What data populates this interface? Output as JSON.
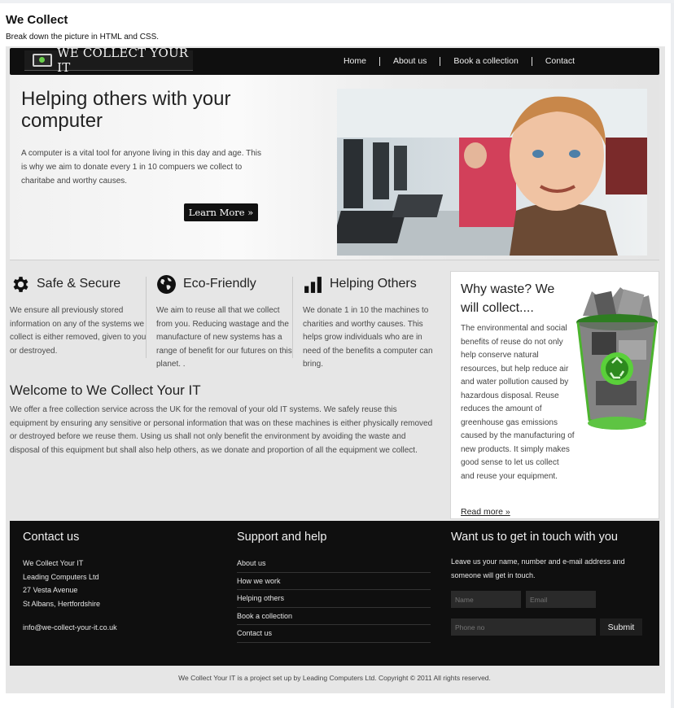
{
  "page": {
    "title": "We Collect",
    "subtitle": "Break down the picture in HTML and CSS."
  },
  "header": {
    "logo_text": "WE COLLECT YOUR IT",
    "nav": [
      "Home",
      "About us",
      "Book a collection",
      "Contact"
    ]
  },
  "hero": {
    "heading": "Helping others with your computer",
    "text": "A computer is a vital tool for anyone living in this day and age. This is why we aim to donate every 1 in 10 compuers we collect to charitabe and worthy causes.",
    "button": "Learn More »"
  },
  "features": [
    {
      "icon": "gear-icon",
      "title": "Safe & Secure",
      "text": "We ensure all previously stored information on any of the systems we collect is either removed, given to you or destroyed."
    },
    {
      "icon": "globe-icon",
      "title": "Eco-Friendly",
      "text": "We aim to reuse all that we collect from you. Reducing wastage and the manufacture of new systems has a range of benefit for our futures on this planet. ."
    },
    {
      "icon": "bar-chart-icon",
      "title": "Helping Others",
      "text": "We donate 1 in 10 the machines to charities and worthy causes. This helps grow individuals who are in need of the benefits a computer can bring."
    }
  ],
  "welcome": {
    "heading": "Welcome to We Collect Your IT",
    "text": "We offer a free collection service across the UK for the removal of your old IT systems. We safely reuse this equipment by ensuring any sensitive or personal information that was on these machines is either physically removed or destroyed before we reuse them. Using us shall not only benefit the environment by avoiding the waste and disposal of this equipment but shall also help others, as we donate and proportion of all the equipment we collect."
  },
  "sidebar": {
    "heading": "Why waste? We will collect....",
    "text": "The environmental and social benefits of reuse do not only help conserve natural resources, but help reduce air and water pollution caused by hazardous disposal. Reuse reduces the amount of greenhouse gas emissions caused by the manufacturing of new products. It simply makes good sense to let us collect and reuse your equipment.",
    "read_more": "Read more »"
  },
  "footer": {
    "contact": {
      "heading": "Contact us",
      "lines": [
        "We Collect Your IT",
        "Leading Computers Ltd",
        "27 Vesta Avenue",
        "St Albans, Hertfordshire"
      ],
      "email": "info@we-collect-your-it.co.uk"
    },
    "support": {
      "heading": "Support and help",
      "links": [
        "About us",
        "How we work",
        "Helping others",
        "Book a collection",
        "Contact us"
      ]
    },
    "touch": {
      "heading": "Want us to get in touch with you",
      "text": "Leave us your name, number and e-mail address and someone will get in touch.",
      "name_placeholder": "Name",
      "email_placeholder": "Email",
      "phone_placeholder": "Phone no",
      "submit": "Submit"
    }
  },
  "copyright": "We Collect Your IT is a project set up by Leading Computers Ltd. Copyright © 2011 All rights reserved."
}
